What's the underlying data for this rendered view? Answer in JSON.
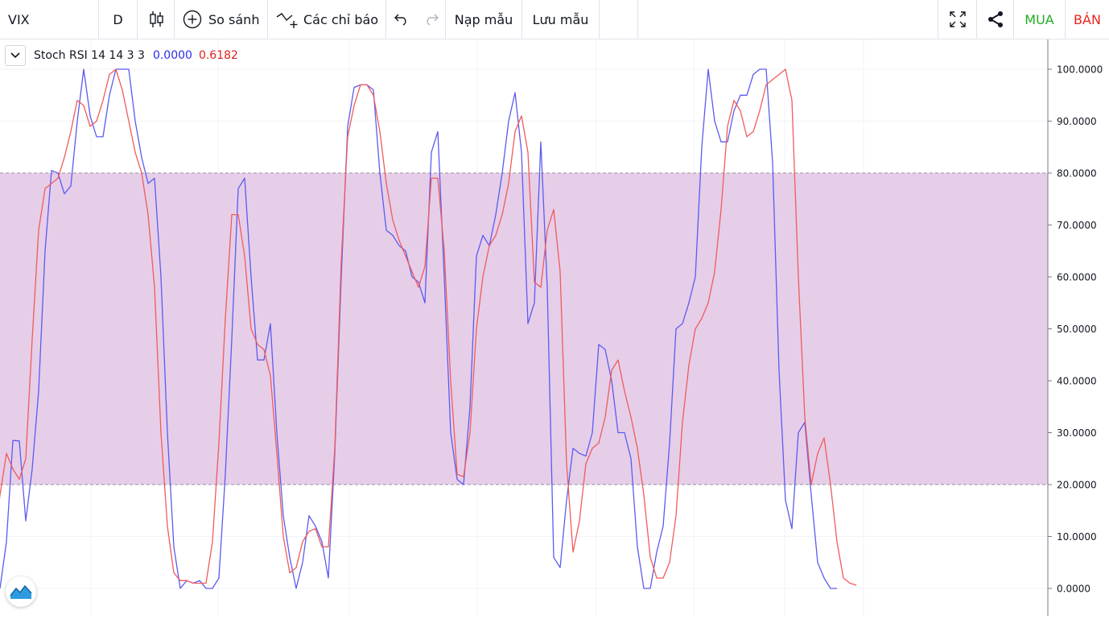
{
  "toolbar": {
    "symbol": "VIX",
    "interval": "D",
    "compare_label": "So sánh",
    "indicators_label": "Các chỉ báo",
    "load_template_label": "Nạp mẫu",
    "save_template_label": "Lưu mẫu",
    "buy_label": "MUA",
    "sell_label": "BÁN"
  },
  "legend": {
    "name": "Stoch RSI 14 14 3 3",
    "k_value": "0.0000",
    "d_value": "0.6182"
  },
  "colors": {
    "k_line": "#5b5bf0",
    "d_line": "#f05b5b",
    "band_fill": "#e3c9e7",
    "buy": "#22ab22",
    "sell": "#e8241c"
  },
  "chart_data": {
    "type": "line",
    "ylim": [
      0,
      100
    ],
    "y_ticks": [
      "100.0000",
      "90.0000",
      "80.0000",
      "70.0000",
      "60.0000",
      "50.0000",
      "40.0000",
      "30.0000",
      "20.0000",
      "10.0000",
      "0.0000"
    ],
    "band": {
      "upper": 80,
      "lower": 20
    },
    "series": [
      {
        "key": "k",
        "values": [
          0,
          9,
          28.5,
          28.4,
          13,
          23,
          38,
          65,
          80.5,
          80,
          76,
          77.5,
          90,
          100,
          91,
          87,
          87,
          95,
          100,
          100,
          100,
          90,
          83,
          78,
          79,
          60,
          30,
          8,
          0,
          1.5,
          1,
          1.5,
          0,
          0,
          2,
          22,
          48,
          77,
          79,
          60,
          44,
          44,
          51,
          30,
          14,
          6,
          0,
          5,
          14,
          12,
          9,
          2,
          26,
          60,
          89,
          96.5,
          97,
          97,
          96,
          80,
          69,
          68,
          66,
          65,
          60,
          59,
          55,
          84,
          88,
          60,
          30,
          21,
          20,
          35,
          64,
          68,
          66,
          72,
          80,
          90,
          95.5,
          84,
          51,
          55,
          86,
          58,
          6,
          4,
          17,
          27,
          26,
          25.5,
          30,
          47,
          46,
          40,
          30,
          30,
          25,
          8,
          0,
          0,
          7,
          12,
          28,
          50,
          51,
          55,
          60,
          85,
          100,
          90,
          86,
          86,
          92,
          95,
          95,
          99,
          100,
          100,
          82,
          42,
          17,
          11.5,
          30,
          32,
          18,
          5,
          2,
          0,
          0
        ],
        "x_start": 0
      },
      {
        "key": "d",
        "values": [
          6,
          8,
          18,
          26,
          23,
          21,
          25,
          48,
          69,
          77,
          78,
          79,
          83,
          88,
          94,
          93,
          89,
          90,
          94,
          99,
          100,
          96,
          90,
          84,
          80,
          72,
          58,
          30,
          12,
          3,
          1.5,
          1.5,
          1,
          1,
          1,
          9,
          28,
          52,
          72,
          72,
          64,
          50,
          47,
          46,
          41,
          26,
          10,
          3,
          4,
          9,
          11,
          11.5,
          8,
          8,
          27,
          63,
          87,
          93,
          97,
          97,
          95,
          88,
          78,
          71,
          67,
          64,
          61,
          58,
          62,
          79,
          79,
          65,
          40,
          22,
          21.5,
          30,
          50,
          60,
          66,
          68,
          72,
          78,
          88,
          91,
          84,
          59,
          58,
          69,
          73,
          61,
          24,
          7,
          13,
          24,
          27,
          28,
          33,
          42,
          44,
          38,
          33,
          27,
          18,
          6,
          2,
          2,
          5,
          14,
          32,
          43,
          50,
          52,
          55,
          61,
          73,
          89,
          94,
          92,
          87,
          88,
          92,
          97,
          98,
          99,
          100,
          94,
          60,
          33,
          20,
          26,
          29,
          20,
          9,
          2,
          1,
          0.6182
        ],
        "x_start": -2
      }
    ]
  }
}
